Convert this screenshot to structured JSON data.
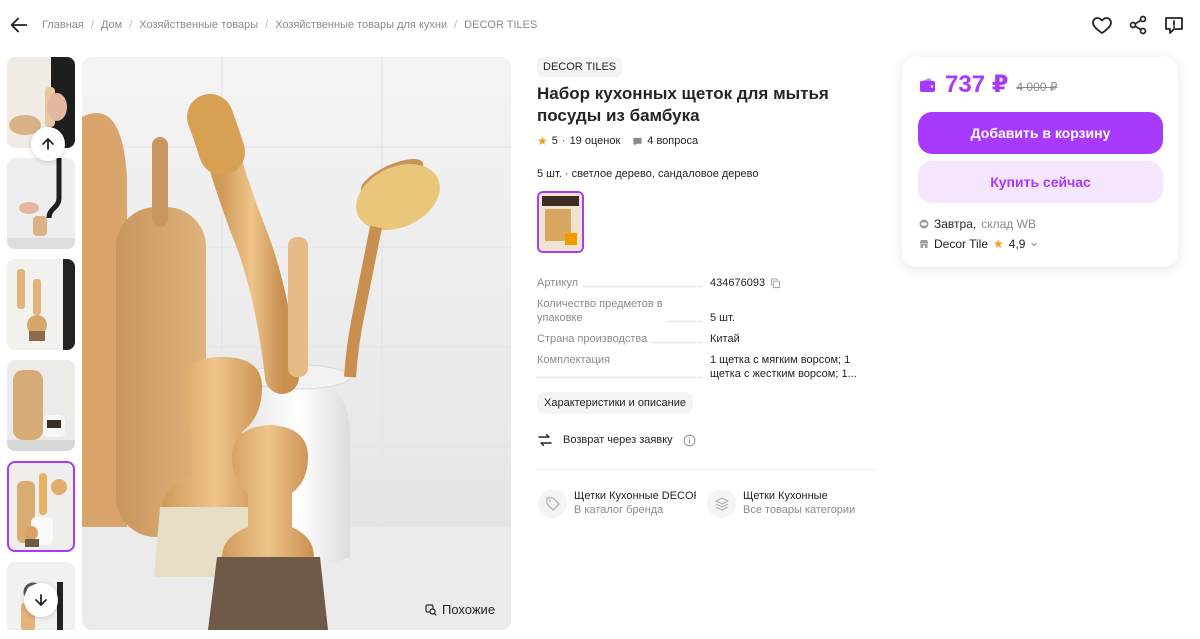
{
  "breadcrumbs": [
    "Главная",
    "Дом",
    "Хозяйственные товары",
    "Хозяйственные товары для кухни",
    "DECOR TILES"
  ],
  "breadcrumb_separator": "/",
  "similar_button": "Похожие",
  "product": {
    "brand": "DECOR TILES",
    "title": "Набор кухонных щеток для мытья посуды из бамбука",
    "rating": "5",
    "reviews": "19 оценок",
    "questions": "4 вопроса",
    "variant_text": "5 шт. · светлое дерево, сандаловое дерево"
  },
  "specs": [
    {
      "name": "Артикул",
      "value": "434676093"
    },
    {
      "name": "Количество предметов в упаковке",
      "value": "5 шт."
    },
    {
      "name": "Страна производства",
      "value": "Китай"
    },
    {
      "name": "Комплектация",
      "value": "1 щетка с мягким ворсом; 1 щетка с жестким ворсом; 1..."
    }
  ],
  "characteristics_button": "Характеристики и описание",
  "return_text": "Возврат через заявку",
  "catalog_links": [
    {
      "title": "Щетки Кухонные DECOR",
      "subtitle": "В каталог бренда"
    },
    {
      "title": "Щетки Кухонные",
      "subtitle": "Все товары категории"
    }
  ],
  "buy_card": {
    "price": "737 ₽",
    "old_price": "4 000 ₽",
    "add_to_cart": "Добавить в корзину",
    "buy_now": "Купить сейчас",
    "delivery_day": "Завтра,",
    "delivery_warehouse": "склад WB",
    "seller": "Decor Tile",
    "seller_rating": "4,9"
  },
  "colors": {
    "accent": "#a73afd",
    "accent_light": "#f5e6fd",
    "star": "#f79e1b",
    "muted": "#8b8b8b"
  },
  "icons": [
    "back-arrow-icon",
    "heart-icon",
    "share-icon",
    "report-icon",
    "arrow-up-icon",
    "arrow-down-icon",
    "similar-icon",
    "star-icon",
    "question-icon",
    "copy-icon",
    "return-icon",
    "info-icon",
    "tag-icon",
    "layers-icon",
    "wallet-icon",
    "truck-icon",
    "shop-icon",
    "chevron-down-icon"
  ]
}
